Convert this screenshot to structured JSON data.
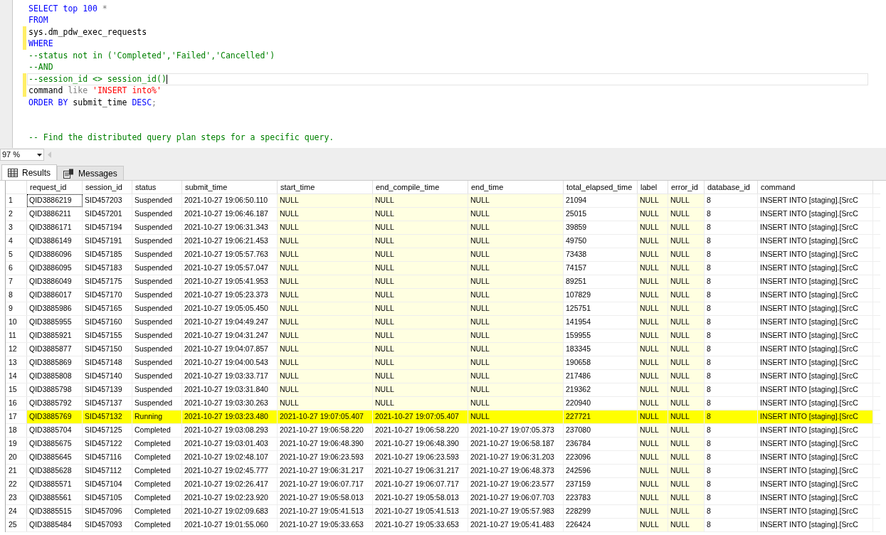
{
  "editor": {
    "lines": [
      {
        "modified": false,
        "current": false,
        "tokens": [
          {
            "kind": "keyword",
            "text": "SELECT top 100 "
          },
          {
            "kind": "operator",
            "text": "*"
          }
        ]
      },
      {
        "modified": false,
        "current": false,
        "tokens": [
          {
            "kind": "keyword",
            "text": "FROM"
          }
        ]
      },
      {
        "modified": true,
        "current": false,
        "tokens": [
          {
            "kind": "plain",
            "text": "sys.dm_pdw_exec_requests"
          }
        ]
      },
      {
        "modified": true,
        "current": false,
        "tokens": [
          {
            "kind": "keyword",
            "text": "WHERE"
          }
        ]
      },
      {
        "modified": false,
        "current": false,
        "tokens": [
          {
            "kind": "comment",
            "text": "--status not in ('Completed','Failed','Cancelled')"
          }
        ]
      },
      {
        "modified": false,
        "current": false,
        "tokens": [
          {
            "kind": "comment",
            "text": "--AND"
          }
        ]
      },
      {
        "modified": true,
        "current": true,
        "tokens": [
          {
            "kind": "comment",
            "text": "--session_id <> session_id()"
          }
        ]
      },
      {
        "modified": true,
        "current": false,
        "tokens": [
          {
            "kind": "plain",
            "text": "command "
          },
          {
            "kind": "operator",
            "text": "like "
          },
          {
            "kind": "string",
            "text": "'INSERT into%'"
          }
        ]
      },
      {
        "modified": false,
        "current": false,
        "tokens": [
          {
            "kind": "keyword",
            "text": "ORDER BY "
          },
          {
            "kind": "plain",
            "text": "submit_time "
          },
          {
            "kind": "keyword",
            "text": "DESC"
          },
          {
            "kind": "operator",
            "text": ";"
          }
        ]
      },
      {
        "modified": false,
        "current": false
      },
      {
        "modified": false,
        "current": false
      },
      {
        "modified": false,
        "current": false,
        "tokens": [
          {
            "kind": "comment",
            "text": "-- Find the distributed query plan steps for a specific query."
          }
        ]
      }
    ]
  },
  "zoom": {
    "value": "97 %"
  },
  "tabs": [
    {
      "label": "Results",
      "selected": true,
      "kind": "grid"
    },
    {
      "label": "Messages",
      "selected": false,
      "kind": "messages"
    }
  ],
  "table": {
    "columns": [
      "request_id",
      "session_id",
      "status",
      "submit_time",
      "start_time",
      "end_compile_time",
      "end_time",
      "total_elapsed_time",
      "label",
      "error_id",
      "database_id",
      "command"
    ],
    "rows": [
      {
        "number": "1",
        "highlighted": false,
        "focused": true,
        "null_shaded": [
          false,
          false,
          false,
          false,
          true,
          true,
          true,
          false,
          true,
          true,
          false,
          false
        ],
        "cells": [
          "QID3886219",
          "SID457203",
          "Suspended",
          "2021-10-27 19:06:50.110",
          "NULL",
          "NULL",
          "NULL",
          "21094",
          "NULL",
          "NULL",
          "8",
          "INSERT INTO [staging].[SrcC"
        ]
      },
      {
        "number": "2",
        "highlighted": false,
        "focused": false,
        "null_shaded": [
          false,
          false,
          false,
          false,
          true,
          true,
          true,
          false,
          true,
          true,
          false,
          false
        ],
        "cells": [
          "QID3886211",
          "SID457201",
          "Suspended",
          "2021-10-27 19:06:46.187",
          "NULL",
          "NULL",
          "NULL",
          "25015",
          "NULL",
          "NULL",
          "8",
          "INSERT INTO [staging].[SrcC"
        ]
      },
      {
        "number": "3",
        "highlighted": false,
        "focused": false,
        "null_shaded": [
          false,
          false,
          false,
          false,
          true,
          true,
          true,
          false,
          true,
          true,
          false,
          false
        ],
        "cells": [
          "QID3886171",
          "SID457194",
          "Suspended",
          "2021-10-27 19:06:31.343",
          "NULL",
          "NULL",
          "NULL",
          "39859",
          "NULL",
          "NULL",
          "8",
          "INSERT INTO [staging].[SrcC"
        ]
      },
      {
        "number": "4",
        "highlighted": false,
        "focused": false,
        "null_shaded": [
          false,
          false,
          false,
          false,
          true,
          true,
          true,
          false,
          true,
          true,
          false,
          false
        ],
        "cells": [
          "QID3886149",
          "SID457191",
          "Suspended",
          "2021-10-27 19:06:21.453",
          "NULL",
          "NULL",
          "NULL",
          "49750",
          "NULL",
          "NULL",
          "8",
          "INSERT INTO [staging].[SrcC"
        ]
      },
      {
        "number": "5",
        "highlighted": false,
        "focused": false,
        "null_shaded": [
          false,
          false,
          false,
          false,
          true,
          true,
          true,
          false,
          true,
          true,
          false,
          false
        ],
        "cells": [
          "QID3886096",
          "SID457185",
          "Suspended",
          "2021-10-27 19:05:57.763",
          "NULL",
          "NULL",
          "NULL",
          "73438",
          "NULL",
          "NULL",
          "8",
          "INSERT INTO [staging].[SrcC"
        ]
      },
      {
        "number": "6",
        "highlighted": false,
        "focused": false,
        "null_shaded": [
          false,
          false,
          false,
          false,
          true,
          true,
          true,
          false,
          true,
          true,
          false,
          false
        ],
        "cells": [
          "QID3886095",
          "SID457183",
          "Suspended",
          "2021-10-27 19:05:57.047",
          "NULL",
          "NULL",
          "NULL",
          "74157",
          "NULL",
          "NULL",
          "8",
          "INSERT INTO [staging].[SrcC"
        ]
      },
      {
        "number": "7",
        "highlighted": false,
        "focused": false,
        "null_shaded": [
          false,
          false,
          false,
          false,
          true,
          true,
          true,
          false,
          true,
          true,
          false,
          false
        ],
        "cells": [
          "QID3886049",
          "SID457175",
          "Suspended",
          "2021-10-27 19:05:41.953",
          "NULL",
          "NULL",
          "NULL",
          "89251",
          "NULL",
          "NULL",
          "8",
          "INSERT INTO [staging].[SrcC"
        ]
      },
      {
        "number": "8",
        "highlighted": false,
        "focused": false,
        "null_shaded": [
          false,
          false,
          false,
          false,
          true,
          true,
          true,
          false,
          true,
          true,
          false,
          false
        ],
        "cells": [
          "QID3886017",
          "SID457170",
          "Suspended",
          "2021-10-27 19:05:23.373",
          "NULL",
          "NULL",
          "NULL",
          "107829",
          "NULL",
          "NULL",
          "8",
          "INSERT INTO [staging].[SrcC"
        ]
      },
      {
        "number": "9",
        "highlighted": false,
        "focused": false,
        "null_shaded": [
          false,
          false,
          false,
          false,
          true,
          true,
          true,
          false,
          true,
          true,
          false,
          false
        ],
        "cells": [
          "QID3885986",
          "SID457165",
          "Suspended",
          "2021-10-27 19:05:05.450",
          "NULL",
          "NULL",
          "NULL",
          "125751",
          "NULL",
          "NULL",
          "8",
          "INSERT INTO [staging].[SrcC"
        ]
      },
      {
        "number": "10",
        "highlighted": false,
        "focused": false,
        "null_shaded": [
          false,
          false,
          false,
          false,
          true,
          true,
          true,
          false,
          true,
          true,
          false,
          false
        ],
        "cells": [
          "QID3885955",
          "SID457160",
          "Suspended",
          "2021-10-27 19:04:49.247",
          "NULL",
          "NULL",
          "NULL",
          "141954",
          "NULL",
          "NULL",
          "8",
          "INSERT INTO [staging].[SrcC"
        ]
      },
      {
        "number": "11",
        "highlighted": false,
        "focused": false,
        "null_shaded": [
          false,
          false,
          false,
          false,
          true,
          true,
          true,
          false,
          true,
          true,
          false,
          false
        ],
        "cells": [
          "QID3885921",
          "SID457155",
          "Suspended",
          "2021-10-27 19:04:31.247",
          "NULL",
          "NULL",
          "NULL",
          "159955",
          "NULL",
          "NULL",
          "8",
          "INSERT INTO [staging].[SrcC"
        ]
      },
      {
        "number": "12",
        "highlighted": false,
        "focused": false,
        "null_shaded": [
          false,
          false,
          false,
          false,
          true,
          true,
          true,
          false,
          true,
          true,
          false,
          false
        ],
        "cells": [
          "QID3885877",
          "SID457150",
          "Suspended",
          "2021-10-27 19:04:07.857",
          "NULL",
          "NULL",
          "NULL",
          "183345",
          "NULL",
          "NULL",
          "8",
          "INSERT INTO [staging].[SrcC"
        ]
      },
      {
        "number": "13",
        "highlighted": false,
        "focused": false,
        "null_shaded": [
          false,
          false,
          false,
          false,
          true,
          true,
          true,
          false,
          true,
          true,
          false,
          false
        ],
        "cells": [
          "QID3885869",
          "SID457148",
          "Suspended",
          "2021-10-27 19:04:00.543",
          "NULL",
          "NULL",
          "NULL",
          "190658",
          "NULL",
          "NULL",
          "8",
          "INSERT INTO [staging].[SrcC"
        ]
      },
      {
        "number": "14",
        "highlighted": false,
        "focused": false,
        "null_shaded": [
          false,
          false,
          false,
          false,
          true,
          true,
          true,
          false,
          true,
          true,
          false,
          false
        ],
        "cells": [
          "QID3885808",
          "SID457140",
          "Suspended",
          "2021-10-27 19:03:33.717",
          "NULL",
          "NULL",
          "NULL",
          "217486",
          "NULL",
          "NULL",
          "8",
          "INSERT INTO [staging].[SrcC"
        ]
      },
      {
        "number": "15",
        "highlighted": false,
        "focused": false,
        "null_shaded": [
          false,
          false,
          false,
          false,
          true,
          true,
          true,
          false,
          true,
          true,
          false,
          false
        ],
        "cells": [
          "QID3885798",
          "SID457139",
          "Suspended",
          "2021-10-27 19:03:31.840",
          "NULL",
          "NULL",
          "NULL",
          "219362",
          "NULL",
          "NULL",
          "8",
          "INSERT INTO [staging].[SrcC"
        ]
      },
      {
        "number": "16",
        "highlighted": false,
        "focused": false,
        "null_shaded": [
          false,
          false,
          false,
          false,
          true,
          true,
          true,
          false,
          true,
          true,
          false,
          false
        ],
        "cells": [
          "QID3885792",
          "SID457137",
          "Suspended",
          "2021-10-27 19:03:30.263",
          "NULL",
          "NULL",
          "NULL",
          "220940",
          "NULL",
          "NULL",
          "8",
          "INSERT INTO [staging].[SrcC"
        ]
      },
      {
        "number": "17",
        "highlighted": true,
        "focused": false,
        "cells": [
          "QID3885769",
          "SID457132",
          "Running",
          "2021-10-27 19:03:23.480",
          "2021-10-27 19:07:05.407",
          "2021-10-27 19:07:05.407",
          "NULL",
          "227721",
          "NULL",
          "NULL",
          "8",
          "INSERT INTO [staging].[SrcC"
        ]
      },
      {
        "number": "18",
        "highlighted": false,
        "focused": false,
        "null_shaded": [
          false,
          false,
          false,
          false,
          false,
          false,
          false,
          false,
          true,
          true,
          false,
          false
        ],
        "cells": [
          "QID3885704",
          "SID457125",
          "Completed",
          "2021-10-27 19:03:08.293",
          "2021-10-27 19:06:58.220",
          "2021-10-27 19:06:58.220",
          "2021-10-27 19:07:05.373",
          "237080",
          "NULL",
          "NULL",
          "8",
          "INSERT INTO [staging].[SrcC"
        ]
      },
      {
        "number": "19",
        "highlighted": false,
        "focused": false,
        "null_shaded": [
          false,
          false,
          false,
          false,
          false,
          false,
          false,
          false,
          true,
          true,
          false,
          false
        ],
        "cells": [
          "QID3885675",
          "SID457122",
          "Completed",
          "2021-10-27 19:03:01.403",
          "2021-10-27 19:06:48.390",
          "2021-10-27 19:06:48.390",
          "2021-10-27 19:06:58.187",
          "236784",
          "NULL",
          "NULL",
          "8",
          "INSERT INTO [staging].[SrcC"
        ]
      },
      {
        "number": "20",
        "highlighted": false,
        "focused": false,
        "null_shaded": [
          false,
          false,
          false,
          false,
          false,
          false,
          false,
          false,
          true,
          true,
          false,
          false
        ],
        "cells": [
          "QID3885645",
          "SID457116",
          "Completed",
          "2021-10-27 19:02:48.107",
          "2021-10-27 19:06:23.593",
          "2021-10-27 19:06:23.593",
          "2021-10-27 19:06:31.203",
          "223096",
          "NULL",
          "NULL",
          "8",
          "INSERT INTO [staging].[SrcC"
        ]
      },
      {
        "number": "21",
        "highlighted": false,
        "focused": false,
        "null_shaded": [
          false,
          false,
          false,
          false,
          false,
          false,
          false,
          false,
          true,
          true,
          false,
          false
        ],
        "cells": [
          "QID3885628",
          "SID457112",
          "Completed",
          "2021-10-27 19:02:45.777",
          "2021-10-27 19:06:31.217",
          "2021-10-27 19:06:31.217",
          "2021-10-27 19:06:48.373",
          "242596",
          "NULL",
          "NULL",
          "8",
          "INSERT INTO [staging].[SrcC"
        ]
      },
      {
        "number": "22",
        "highlighted": false,
        "focused": false,
        "null_shaded": [
          false,
          false,
          false,
          false,
          false,
          false,
          false,
          false,
          true,
          true,
          false,
          false
        ],
        "cells": [
          "QID3885571",
          "SID457104",
          "Completed",
          "2021-10-27 19:02:26.417",
          "2021-10-27 19:06:07.717",
          "2021-10-27 19:06:07.717",
          "2021-10-27 19:06:23.577",
          "237159",
          "NULL",
          "NULL",
          "8",
          "INSERT INTO [staging].[SrcC"
        ]
      },
      {
        "number": "23",
        "highlighted": false,
        "focused": false,
        "null_shaded": [
          false,
          false,
          false,
          false,
          false,
          false,
          false,
          false,
          true,
          true,
          false,
          false
        ],
        "cells": [
          "QID3885561",
          "SID457105",
          "Completed",
          "2021-10-27 19:02:23.920",
          "2021-10-27 19:05:58.013",
          "2021-10-27 19:05:58.013",
          "2021-10-27 19:06:07.703",
          "223783",
          "NULL",
          "NULL",
          "8",
          "INSERT INTO [staging].[SrcC"
        ]
      },
      {
        "number": "24",
        "highlighted": false,
        "focused": false,
        "null_shaded": [
          false,
          false,
          false,
          false,
          false,
          false,
          false,
          false,
          true,
          true,
          false,
          false
        ],
        "cells": [
          "QID3885515",
          "SID457096",
          "Completed",
          "2021-10-27 19:02:09.683",
          "2021-10-27 19:05:41.513",
          "2021-10-27 19:05:41.513",
          "2021-10-27 19:05:57.983",
          "228299",
          "NULL",
          "NULL",
          "8",
          "INSERT INTO [staging].[SrcC"
        ]
      },
      {
        "number": "25",
        "highlighted": false,
        "focused": false,
        "null_shaded": [
          false,
          false,
          false,
          false,
          false,
          false,
          false,
          false,
          true,
          true,
          false,
          false
        ],
        "cells": [
          "QID3885484",
          "SID457093",
          "Completed",
          "2021-10-27 19:01:55.060",
          "2021-10-27 19:05:33.653",
          "2021-10-27 19:05:33.653",
          "2021-10-27 19:05:41.483",
          "226424",
          "NULL",
          "NULL",
          "8",
          "INSERT INTO [staging].[SrcC"
        ]
      }
    ]
  }
}
